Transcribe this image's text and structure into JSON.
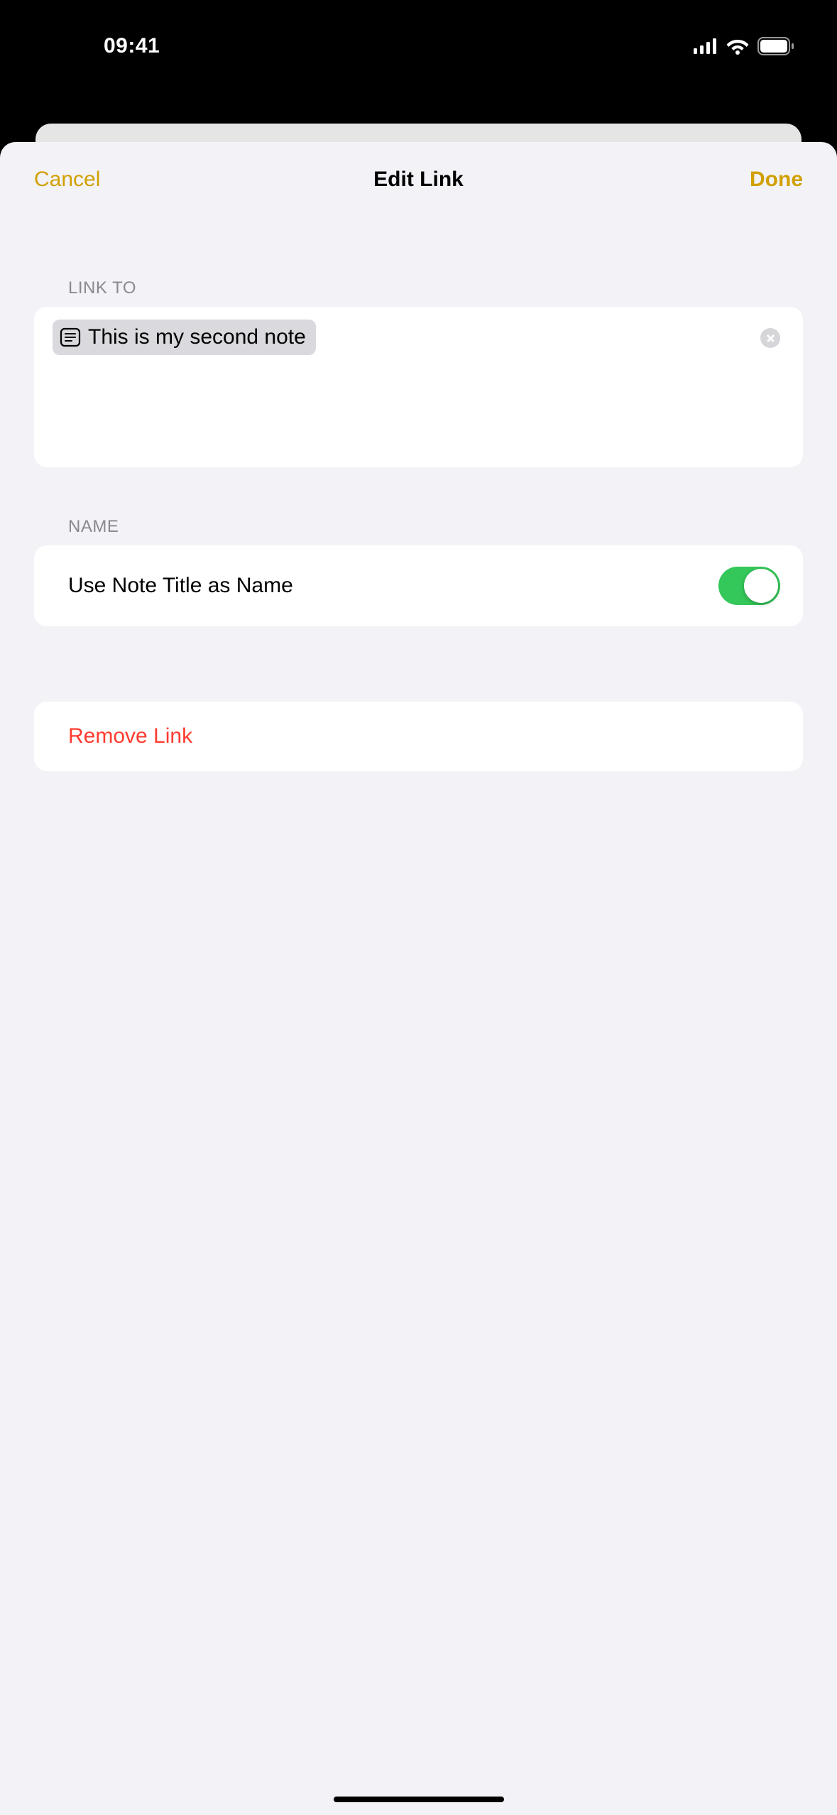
{
  "status": {
    "time": "09:41"
  },
  "sheet": {
    "cancel": "Cancel",
    "title": "Edit Link",
    "done": "Done"
  },
  "linkto": {
    "label": "Link To",
    "note_title": "This is my second note"
  },
  "name": {
    "label": "Name",
    "toggle_label": "Use Note Title as Name",
    "toggle_on": true
  },
  "remove": {
    "label": "Remove Link"
  }
}
